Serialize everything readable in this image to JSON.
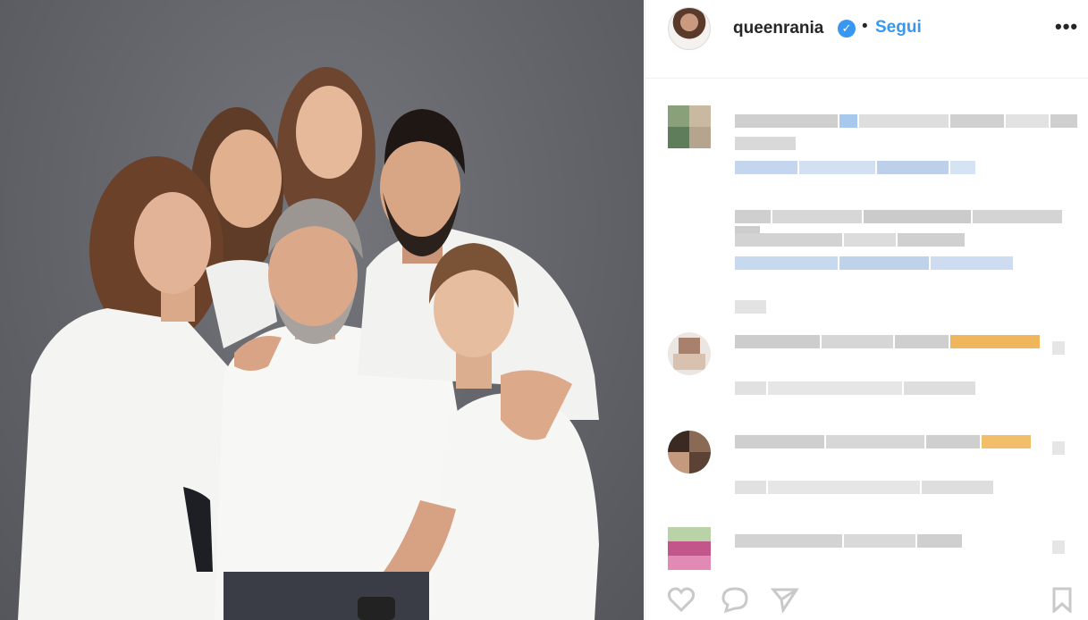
{
  "post": {
    "username": "queenrania",
    "follow_label": "Segui",
    "separator": "•",
    "verified_glyph": "✓",
    "more_glyph": "•••"
  },
  "photo": {
    "alt": "Family portrait",
    "background_color": "#66676d"
  },
  "comments": [
    {
      "avatar_colors": [
        "#8aa07a",
        "#c8b9a0",
        "#5f7d5a",
        "#b5a58f"
      ]
    },
    {
      "avatar_colors": []
    },
    {
      "avatar_colors": [
        "#a9806b",
        "#d9c1b0",
        "#7b5c4a",
        "#c4a795"
      ]
    },
    {
      "avatar_colors": [
        "#3a2a22",
        "#8a6a55",
        "#c49a7e",
        "#5c4234"
      ]
    },
    {
      "avatar_colors": [
        "#c2568a",
        "#7fa06a",
        "#e08ab5",
        "#9a6b5a"
      ]
    }
  ],
  "colors": {
    "accent": "#3897f0",
    "text": "#262626",
    "border": "#efefef"
  },
  "icons": [
    "heart-icon",
    "comment-icon",
    "share-icon",
    "bookmark-icon"
  ]
}
